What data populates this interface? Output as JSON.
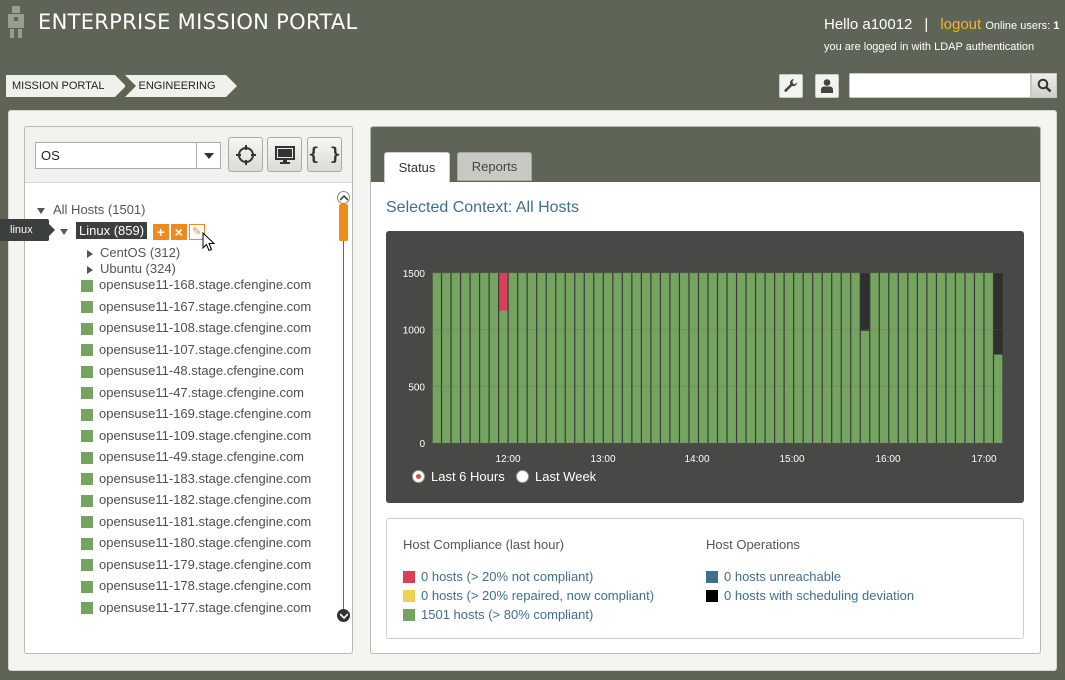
{
  "header": {
    "title": "ENTERPRISE MISSION PORTAL",
    "greeting": "Hello a10012",
    "separator": "|",
    "logout_label": "logout",
    "online_label": "Online users:",
    "online_count": "1",
    "auth_note": "you are logged in with LDAP authentication"
  },
  "breadcrumb": [
    "MISSION PORTAL",
    "ENGINEERING"
  ],
  "toolbar": {
    "settings_icon": "wrench-icon",
    "user_icon": "user-icon",
    "search_placeholder": "",
    "search_icon": "magnifier-icon"
  },
  "left_panel": {
    "context_select": "OS",
    "buttons": [
      "crosshair-icon",
      "monitor-icon",
      "braces-icon"
    ],
    "tooltip": "linux",
    "tree": {
      "root": "All Hosts (1501)",
      "selected": "Linux (859)",
      "children": [
        "CentOS (312)",
        "Ubuntu (324)"
      ],
      "hosts": [
        "opensuse11-168.stage.cfengine.com",
        "opensuse11-167.stage.cfengine.com",
        "opensuse11-108.stage.cfengine.com",
        "opensuse11-107.stage.cfengine.com",
        "opensuse11-48.stage.cfengine.com",
        "opensuse11-47.stage.cfengine.com",
        "opensuse11-169.stage.cfengine.com",
        "opensuse11-109.stage.cfengine.com",
        "opensuse11-49.stage.cfengine.com",
        "opensuse11-183.stage.cfengine.com",
        "opensuse11-182.stage.cfengine.com",
        "opensuse11-181.stage.cfengine.com",
        "opensuse11-180.stage.cfengine.com",
        "opensuse11-179.stage.cfengine.com",
        "opensuse11-178.stage.cfengine.com",
        "opensuse11-177.stage.cfengine.com"
      ]
    }
  },
  "right_panel": {
    "tabs": [
      "Status",
      "Reports"
    ],
    "active_tab": "Status",
    "context_heading": "Selected Context: All Hosts",
    "range_options": [
      "Last 6 Hours",
      "Last Week"
    ],
    "selected_range": "Last 6 Hours",
    "summary": {
      "compliance_title": "Host Compliance (last hour)",
      "operations_title": "Host Operations",
      "compliance_items": [
        {
          "label": "0 hosts (> 20% not compliant)",
          "color": "#d8405a"
        },
        {
          "label": "0 hosts (> 20% repaired, now compliant)",
          "color": "#efd050"
        },
        {
          "label": "1501 hosts (> 80% compliant)",
          "color": "#74a460"
        }
      ],
      "operations_items": [
        {
          "label": "0 hosts unreachable",
          "color": "#3f6f8f"
        },
        {
          "label": "0 hosts with scheduling deviation",
          "color": "#000000"
        }
      ]
    }
  },
  "chart_data": {
    "type": "bar",
    "stacked": true,
    "ylim": [
      0,
      1500
    ],
    "yticks": [
      "1500",
      "1000",
      "500",
      "0"
    ],
    "xticks": [
      "12:00",
      "13:00",
      "14:00",
      "15:00",
      "16:00",
      "17:00"
    ],
    "num_bars": 60,
    "total_per_bar": 1501,
    "series": [
      {
        "name": "compliant",
        "color": "#74a460"
      },
      {
        "name": "not compliant",
        "color": "#d8405a",
        "bars": [
          {
            "index": 7,
            "value": 330
          }
        ]
      },
      {
        "name": "scheduling deviation",
        "color": "#2f302e",
        "bars": [
          {
            "index": 45,
            "value": 510
          },
          {
            "index": 59,
            "value": 720
          }
        ]
      }
    ],
    "grid": true,
    "background": "#484946"
  }
}
